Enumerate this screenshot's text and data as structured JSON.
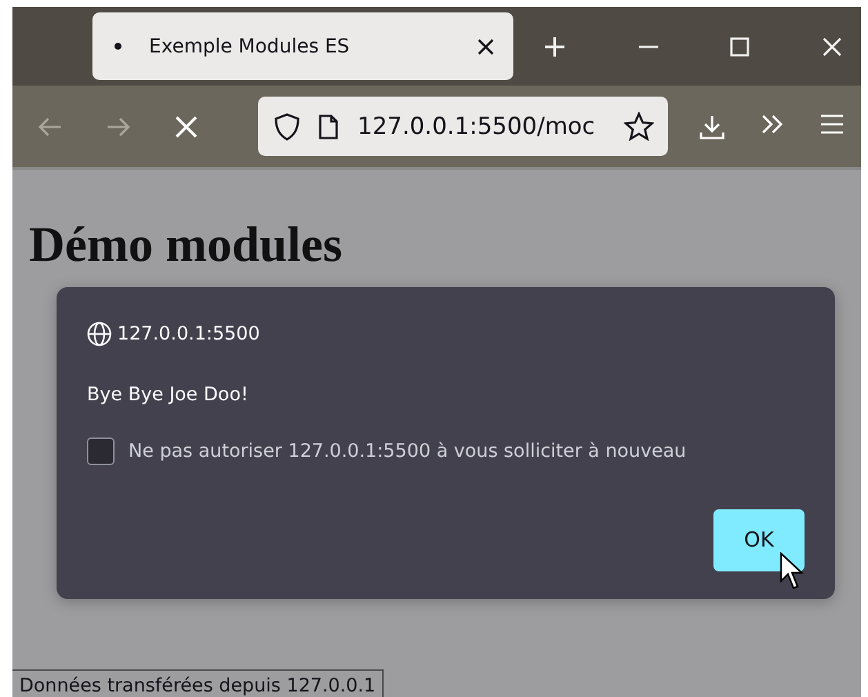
{
  "browser": {
    "tab": {
      "title": "Exemple Modules ES",
      "selected": true
    },
    "url": "127.0.0.1:5500/moc"
  },
  "page": {
    "heading": "Démo modules"
  },
  "dialog": {
    "origin": "127.0.0.1:5500",
    "message": "Bye Bye Joe Doo!",
    "checkbox": {
      "label": "Ne pas autoriser 127.0.0.1:5500 à vous solliciter à nouveau",
      "checked": false
    },
    "button": "OK"
  },
  "status_bar": "Données transférées depuis 127.0.0.1"
}
